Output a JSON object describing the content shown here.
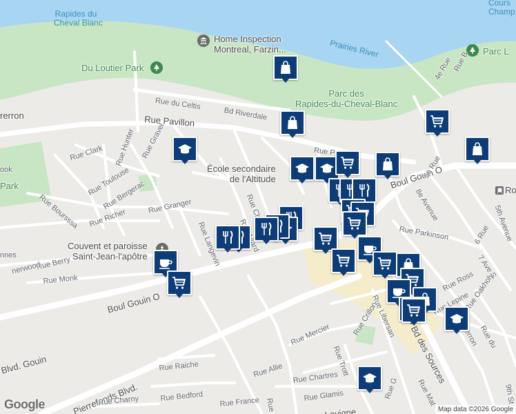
{
  "map": {
    "places": [
      {
        "name": "Home Inspection Montreal, Farzin...",
        "lines": [
          "Home Inspection",
          "Montreal, Farzin..."
        ]
      },
      {
        "name": "Du Loutier Park"
      },
      {
        "name": "Parc des Rapides-du-Cheval-Blanc",
        "lines": [
          "Parc des",
          "Rapides-du-Cheval-Blanc"
        ]
      },
      {
        "name": "École secondaire de l'Altitude",
        "lines": [
          "École secondaire",
          "de l'Altitude"
        ]
      },
      {
        "name": "Couvent et paroisse Saint-Jean-l'apôtre",
        "lines": [
          "Couvent et paroisse",
          "Saint-Jean-l'apôtre"
        ]
      },
      {
        "name": "Roxboro-Pierrefo"
      },
      {
        "name": "Parc L"
      },
      {
        "name": "Park"
      },
      {
        "name": "Rapides du Cheval Blanc",
        "lines": [
          "Rapides du",
          "Cheval Blanc"
        ]
      },
      {
        "name": "Prairies River"
      },
      {
        "name": "Cours Champ",
        "lines": [
          "Cours",
          "Champ"
        ]
      }
    ],
    "streets": [
      "Rue du Celtis",
      "Bd Riverdale",
      "Rue Pavillon",
      "Rue Clark",
      "Rue Hunter",
      "Rue Gravel",
      "Rue Toulouse",
      "Rue Bergerac",
      "Rue Boursssa",
      "Rue Richer",
      "Rue Granger",
      "Rue Langevin",
      "Rue Ch",
      "Rue Allard",
      "Rue Berry",
      "Rue Monk",
      "Boul Gouin O",
      "Rue Parkinson",
      "8e Avenue",
      "5e Rue",
      "4e Rue",
      "6 Rue",
      "5th Avenue",
      "7 Ave S",
      "Rue Ross",
      "Rue Lepine",
      "Rue Oakholy",
      "Rue du",
      "Rue Crillon",
      "Rue Libersan",
      "Bd des Sources",
      "Rue Mercier",
      "Rue Trott",
      "Rue Allie",
      "Rue Chartres",
      "Rue Glamis",
      "Rue Raiche",
      "Pierrefonds Blvd.",
      "Blvd. Gouin",
      "Rue Charny",
      "Rue Bedford",
      "Rue France",
      "Rue Dro",
      "Rue Mat",
      "Rue G",
      "9th St",
      "Rue P",
      "nerwood",
      "Rue B",
      "ook",
      "Rue",
      "Rue Ron",
      "Rue Monk",
      "rerron",
      "nnes",
      "Lavigne"
    ],
    "poi_types": {
      "shopping-bag": "shopping-bag-icon",
      "cart": "shopping-cart-icon",
      "school": "graduation-cap-icon",
      "restaurant": "fork-knife-icon",
      "cafe": "coffee-cup-icon"
    },
    "colors": {
      "water": "#a8d5f2",
      "park": "#c8e6c3",
      "road": "#ffffff",
      "land": "#ecebe8",
      "commercial": "#f6ecc8",
      "poi": "#0d3c76",
      "park_pin": "#3c8a4e",
      "landmark_pin": "#6b6b6b"
    }
  },
  "attribution": {
    "logo": "Google",
    "credit": "Map data ©2026 Google"
  }
}
